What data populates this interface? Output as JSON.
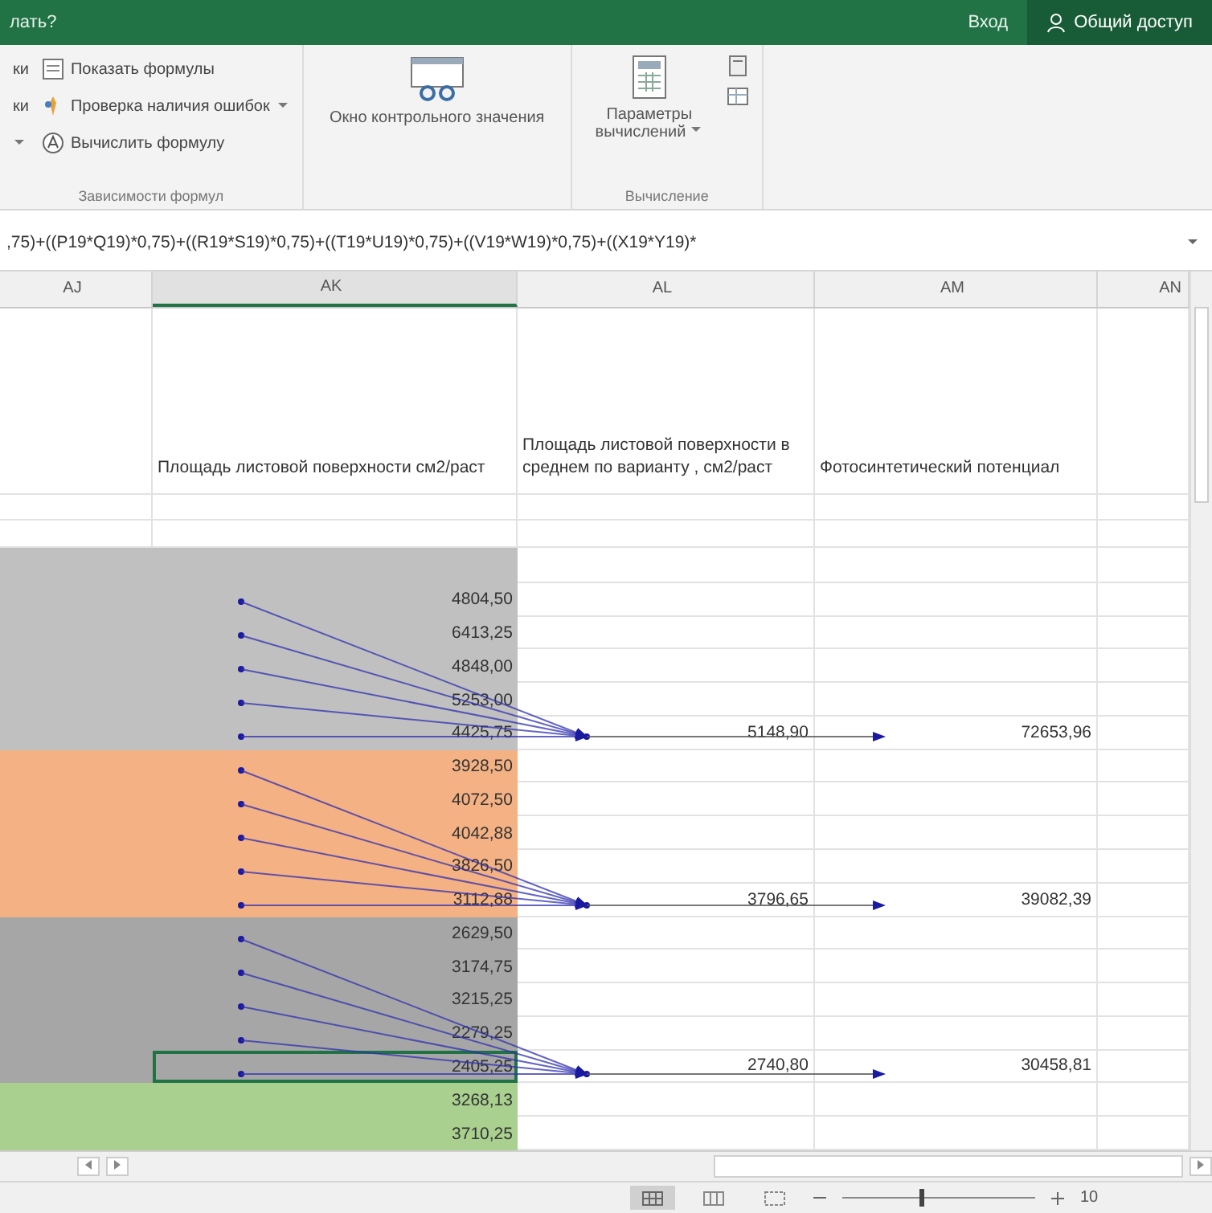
{
  "title_bar": {
    "search_hint": "лать?",
    "sign_in": "Вход",
    "share": "Общий доступ"
  },
  "ribbon": {
    "cut_labels": [
      "ки",
      "ки"
    ],
    "auditing": [
      {
        "label": "Показать формулы",
        "dropdown": false
      },
      {
        "label": "Проверка наличия ошибок",
        "dropdown": true
      },
      {
        "label": "Вычислить формулу",
        "dropdown": false
      }
    ],
    "auditing_group": "Зависимости формул",
    "watch_window": "Окно контрольного значения",
    "calc_options": "Параметры вычислений",
    "calc_group": "Вычисление"
  },
  "formula_bar": {
    "formula": ",75)+((P19*Q19)*0,75)+((R19*S19)*0,75)+((T19*U19)*0,75)+((V19*W19)*0,75)+((X19*Y19)*"
  },
  "columns": [
    "AJ",
    "AK",
    "AL",
    "AM",
    "AN"
  ],
  "header_row": {
    "ak": "Площадь листовой поверхности см2/раст",
    "al": "Площадь листовой поверхности в среднем по варианту , см2/раст",
    "am": "Фотосинтетический потенциал"
  },
  "groups": [
    {
      "color": "#c0c0c0",
      "cells": [
        {
          "value": "4804,50",
          "selected": false
        },
        {
          "value": "6413,25",
          "selected": false
        },
        {
          "value": "4848,00",
          "selected": false
        },
        {
          "value": "5253,00",
          "selected": false
        },
        {
          "value": "4425,75",
          "selected": false
        }
      ],
      "average": "5148,90",
      "potential": "72653,96"
    },
    {
      "color": "#f4b183",
      "cells": [
        {
          "value": "3928,50",
          "selected": false
        },
        {
          "value": "4072,50",
          "selected": false
        },
        {
          "value": "4042,88",
          "selected": false
        },
        {
          "value": "3826,50",
          "selected": false
        },
        {
          "value": "3112,88",
          "selected": false
        }
      ],
      "average": "3796,65",
      "potential": "39082,39"
    },
    {
      "color": "#a6a6a6",
      "cells": [
        {
          "value": "2629,50",
          "selected": false
        },
        {
          "value": "3174,75",
          "selected": false
        },
        {
          "value": "3215,25",
          "selected": false
        },
        {
          "value": "2279,25",
          "selected": false
        },
        {
          "value": "2405,25",
          "selected": true
        }
      ],
      "average": "2740,80",
      "potential": "30458,81"
    },
    {
      "color": "#a9d08e",
      "cells": [
        {
          "value": "3268,13",
          "selected": false
        },
        {
          "value": "3710,25",
          "selected": false
        }
      ]
    }
  ],
  "status_bar": {
    "zoom": "10",
    "zoom_slider": {
      "level": 0.4
    }
  }
}
